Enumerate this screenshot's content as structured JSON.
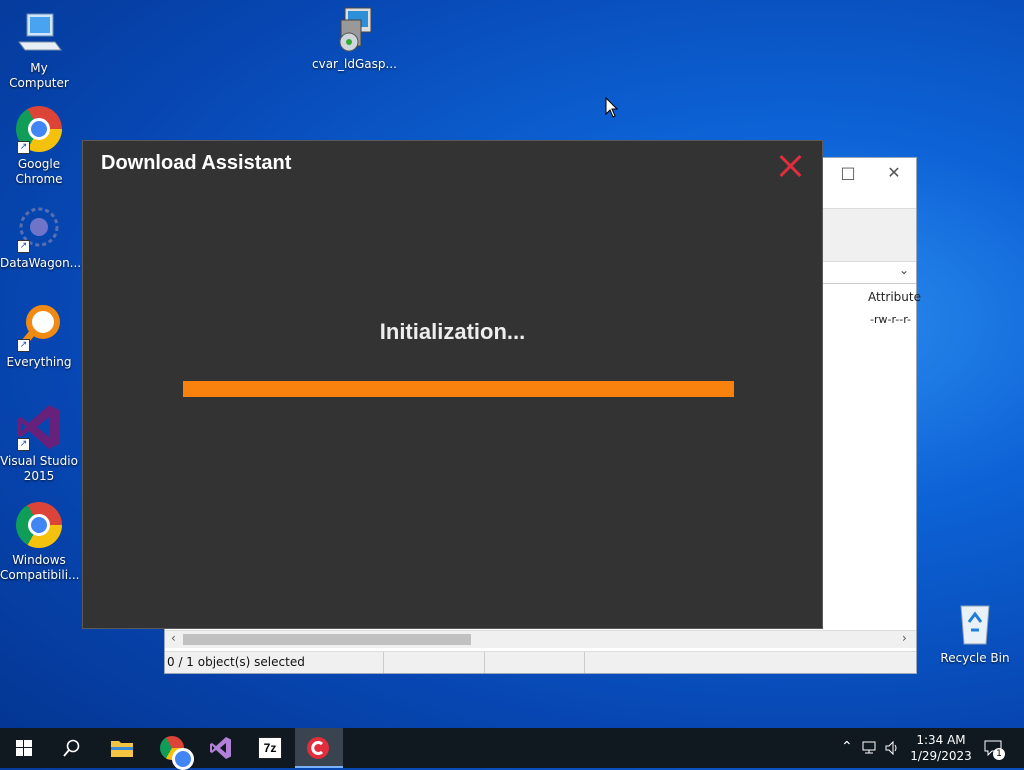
{
  "desktop": {
    "icons": [
      {
        "label": "My Computer"
      },
      {
        "label": "cvar_ldGasp..."
      },
      {
        "label": "Google Chrome"
      },
      {
        "label": "DataWagon..."
      },
      {
        "label": "Everything"
      },
      {
        "label": "Visual Studio 2015"
      },
      {
        "label": "Windows Compatibili..."
      },
      {
        "label": "Recycle Bin"
      }
    ]
  },
  "background_window": {
    "column_header": "Attribute",
    "row_attribute": "-rw-r--r-",
    "status_selected": "0 / 1 object(s) selected"
  },
  "dialog": {
    "title": "Download Assistant",
    "status": "Initialization...",
    "progress_fraction": 1.0,
    "accent_color": "#f8820d",
    "close_color": "#e02e3c"
  },
  "taskbar": {
    "apps": [
      "start-icon",
      "search-icon",
      "file-explorer-icon",
      "chrome-icon",
      "visual-studio-icon",
      "7zip-icon",
      "download-assistant-icon"
    ],
    "sevenzip_label": "7z",
    "time": "1:34 AM",
    "date": "1/29/2023",
    "notification_count": "1"
  }
}
